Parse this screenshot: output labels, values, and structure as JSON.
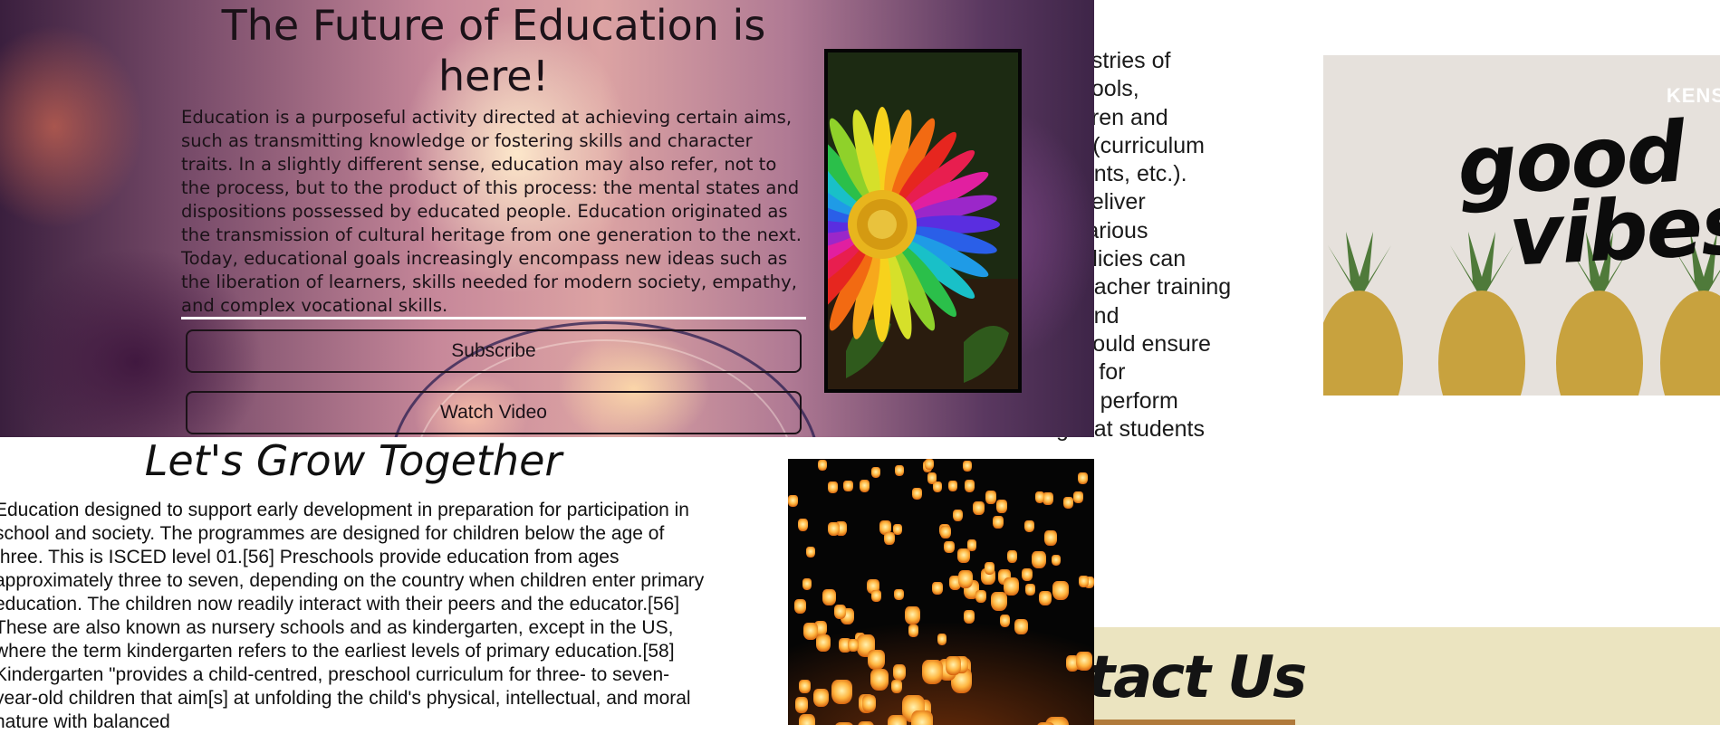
{
  "hero": {
    "title": "The Future of Education is here!",
    "body": "Education is a purposeful activity directed at achieving certain aims, such as transmitting knowledge or fostering skills and character traits. In a slightly different sense, education may also refer, not to the process, but to the product of this process: the mental states and dispositions possessed by educated people. Education originated as the transmission of cultural heritage from one generation to the next. Today, educational goals increasingly encompass new ideas such as the liberation of learners, skills needed for modern society, empathy, and complex vocational skills.",
    "subscribe_label": "Subscribe",
    "watch_video_label": "Watch Video",
    "image_name": "rainbow-daisy-image"
  },
  "side_text": {
    "lines": "ninistries of\nschools,\nhildren and\nple (curriculum\nudents, etc.).\nls deliver\nn various\nl policies can\ne teacher training\ns) and\nt should ensure\ntion for\nd to perform\ng that students"
  },
  "good_vibes": {
    "word1": "good",
    "word2": "vibes",
    "brand": "KENS"
  },
  "grow": {
    "title": "Let's Grow Together",
    "body": "Education designed to support early development in preparation for participation in school and society. The programmes are designed for children below the age of three. This is ISCED level 01.[56] Preschools provide education from ages approximately three to seven, depending on the country when children enter primary education. The children now readily interact with their peers and the educator.[56] These are also known as nursery schools and as kindergarten, except in the US, where the term kindergarten refers to the earliest levels of primary education.[58] Kindergarten \"provides a child-centred, preschool curriculum for three- to seven-year-old children that aim[s] at unfolding the child's physical, intellectual, and moral nature with balanced"
  },
  "contact": {
    "title": "Contact Us"
  },
  "colors": {
    "contact_band": "#ebe4c0",
    "button_border": "#1b1218"
  }
}
